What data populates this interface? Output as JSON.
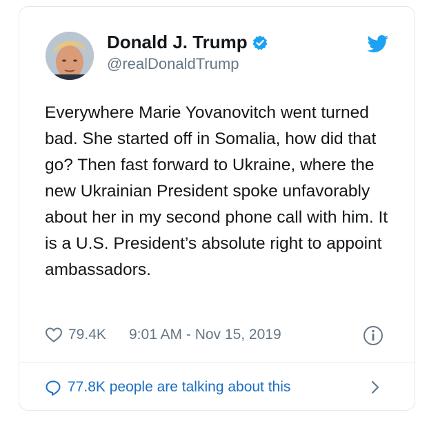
{
  "tweet": {
    "author": {
      "display_name": "Donald J. Trump",
      "handle": "@realDonaldTrump",
      "verified_icon": "verified-badge-icon",
      "avatar": "profile-photo"
    },
    "platform_icon": "twitter-bird-icon",
    "text": "Everywhere Marie Yovanovitch went turned bad. She started off in Somalia, how did that go? Then fast forward to Ukraine, where the new Ukrainian President spoke unfavorably about her in my second phone call with him. It is a U.S. President’s absolute right to appoint ambassadors.",
    "likes": "79.4K",
    "timestamp": "9:01 AM - Nov 15, 2019",
    "conversation": "77.8K people are talking about this"
  },
  "colors": {
    "accent": "#1da1f2",
    "link": "#1b6ec2",
    "text": "#14171a",
    "secondary": "#657786",
    "border": "#e1e8ed"
  }
}
